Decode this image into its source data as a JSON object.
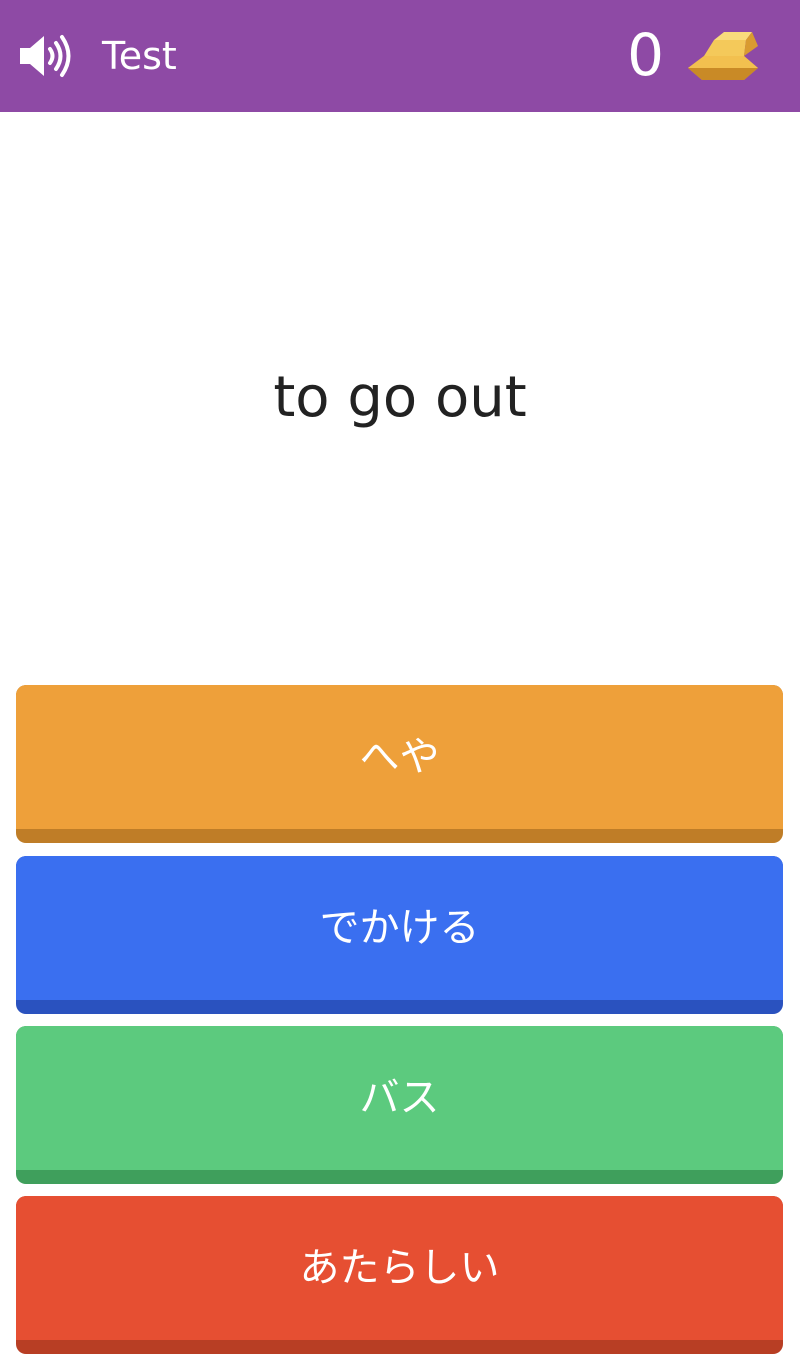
{
  "header": {
    "title": "Test",
    "score": "0",
    "sound_icon": "speaker-icon",
    "currency_icon": "gold-bars-icon",
    "background_color": "#8e4aa5"
  },
  "question": {
    "prompt": "to go out"
  },
  "answers": [
    {
      "label": "へや",
      "color": "#eea03a"
    },
    {
      "label": "でかける",
      "color": "#3a6ff0"
    },
    {
      "label": "バス",
      "color": "#5cca7e"
    },
    {
      "label": "あたらしい",
      "color": "#e64f32"
    }
  ]
}
